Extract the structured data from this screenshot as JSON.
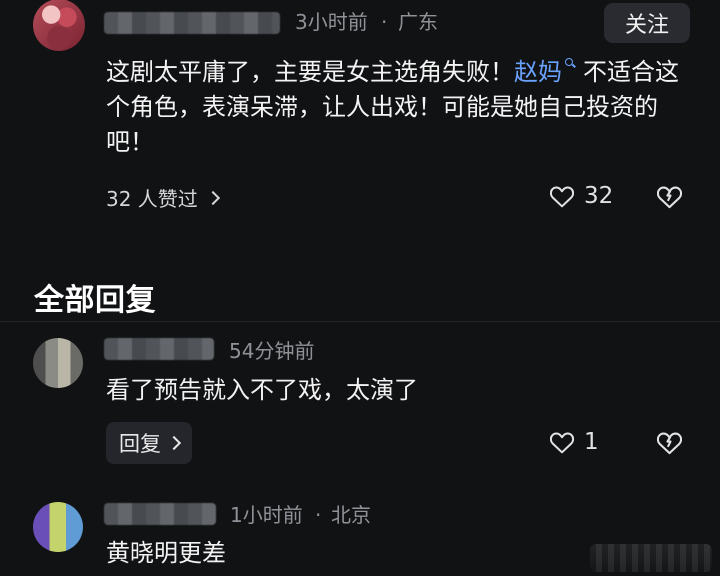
{
  "colors": {
    "background": "#111214",
    "text_primary": "#f3f3f3",
    "text_secondary": "#8f9297",
    "mention": "#6aa3ff",
    "button_bg": "#2a2b30"
  },
  "top_comment": {
    "time": "3小时前",
    "location": "广东",
    "follow_label": "关注",
    "text_before_mention": "这剧太平庸了，主要是女主选角失败！",
    "mention": "赵妈",
    "mention_icon": "search-icon",
    "text_after_mention": "不适合这个角色，表演呆滞，让人出戏！可能是她自己投资的吧！",
    "likes_text": "32 人赞过",
    "like_count": "32",
    "like_icon": "heart-icon",
    "dislike_icon": "broken-heart-icon"
  },
  "section": {
    "title": "全部回复"
  },
  "replies": [
    {
      "time": "54分钟前",
      "text": "看了预告就入不了戏，太演了",
      "reply_label": "回复",
      "like_count": "1"
    },
    {
      "time": "1小时前",
      "location": "北京",
      "text": "黄晓明更差"
    }
  ]
}
